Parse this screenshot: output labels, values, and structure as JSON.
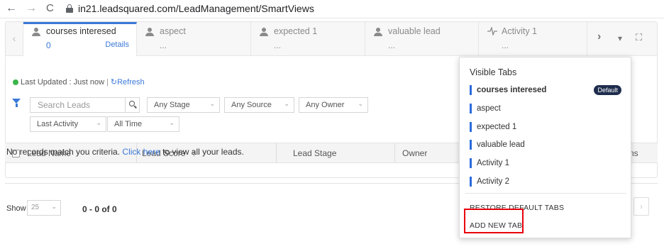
{
  "browser": {
    "back": "←",
    "forward": "→",
    "reload": "C",
    "url": "in21.leadsquared.com/LeadManagement/SmartViews"
  },
  "tabs": [
    {
      "title": "courses interesed",
      "count": "0",
      "details": "Details",
      "active": true
    },
    {
      "title": "aspect",
      "count": "..."
    },
    {
      "title": "expected 1",
      "count": "..."
    },
    {
      "title": "valuable lead",
      "count": "..."
    },
    {
      "title": "Activity 1",
      "count": "..."
    }
  ],
  "tab_tools": {
    "next": "›",
    "dropdown": "▾",
    "expand": "⛶"
  },
  "status": {
    "text": "Last Updated : Just now",
    "refresh": "Refresh",
    "refresh_icon": "↻"
  },
  "filters": {
    "search_placeholder": "Search Leads",
    "stage": "Any Stage",
    "source": "Any Source",
    "owner": "Any Owner",
    "activity": "Last Activity",
    "time": "All Time"
  },
  "grid": {
    "columns": [
      "Lead Name",
      "Lead Score",
      "Lead Stage",
      "Owner",
      "ns"
    ],
    "sort_icon": "↑",
    "empty_text_before": "No records match you criteria.",
    "empty_link": "Click here",
    "empty_text_after": "to view all your leads."
  },
  "pagination": {
    "show_label": "Show",
    "page_size": "25",
    "range": "0 - 0 of 0"
  },
  "menu": {
    "title": "Visible Tabs",
    "items": [
      {
        "label": "courses interesed",
        "badge": "Default"
      },
      {
        "label": "aspect"
      },
      {
        "label": "expected 1"
      },
      {
        "label": "valuable lead"
      },
      {
        "label": "Activity 1"
      },
      {
        "label": "Activity 2"
      }
    ],
    "restore": "RESTORE DEFAULT TABS",
    "add_new": "ADD NEW TAB"
  },
  "colors": {
    "accent": "#3a79d8",
    "highlight": "#e8000d",
    "badge": "#1f2d4d",
    "online": "#3bb54a"
  }
}
